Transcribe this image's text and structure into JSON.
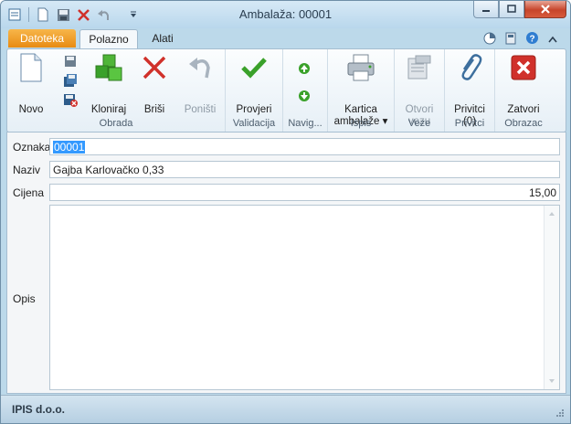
{
  "window": {
    "title": "Ambalaža: 00001"
  },
  "qat": {
    "icons": [
      "app-menu-icon",
      "new-doc-icon",
      "save-icon",
      "delete-x-icon",
      "undo-icon",
      "customize-qat-icon"
    ]
  },
  "tabs": {
    "file": "Datoteka",
    "home": "Polazno",
    "tools": "Alati"
  },
  "ribbon": {
    "obrada": {
      "label": "Obrada",
      "novo": "Novo",
      "kloniraj": "Kloniraj",
      "brisi": "Briši",
      "ponisti": "Poništi"
    },
    "validacija": {
      "label": "Validacija",
      "provjeri": "Provjeri"
    },
    "navig": {
      "label": "Navig..."
    },
    "ispis": {
      "label": "Ispis",
      "kartica_line1": "Kartica",
      "kartica_line2": "ambalaže ▾"
    },
    "veze": {
      "label": "Veze",
      "otvori_line1": "Otvori",
      "otvori_line2": "vezu"
    },
    "privitci": {
      "label": "Privitci",
      "btn_line1": "Privitci",
      "btn_line2": "(0)"
    },
    "obrazac": {
      "label": "Obrazac",
      "zatvori": "Zatvori"
    }
  },
  "form": {
    "oznaka": {
      "label": "Oznaka",
      "value": "00001"
    },
    "naziv": {
      "label": "Naziv",
      "value": "Gajba Karlovačko 0,33"
    },
    "cijena": {
      "label": "Cijena",
      "value": "15,00"
    },
    "opis": {
      "label": "Opis",
      "value": ""
    }
  },
  "status": {
    "company": "IPIS d.o.o."
  },
  "colors": {
    "file_tab": "#e88b12",
    "close_btn": "#c7452b",
    "accent_green": "#3aa12a",
    "accent_red": "#d0312b"
  }
}
